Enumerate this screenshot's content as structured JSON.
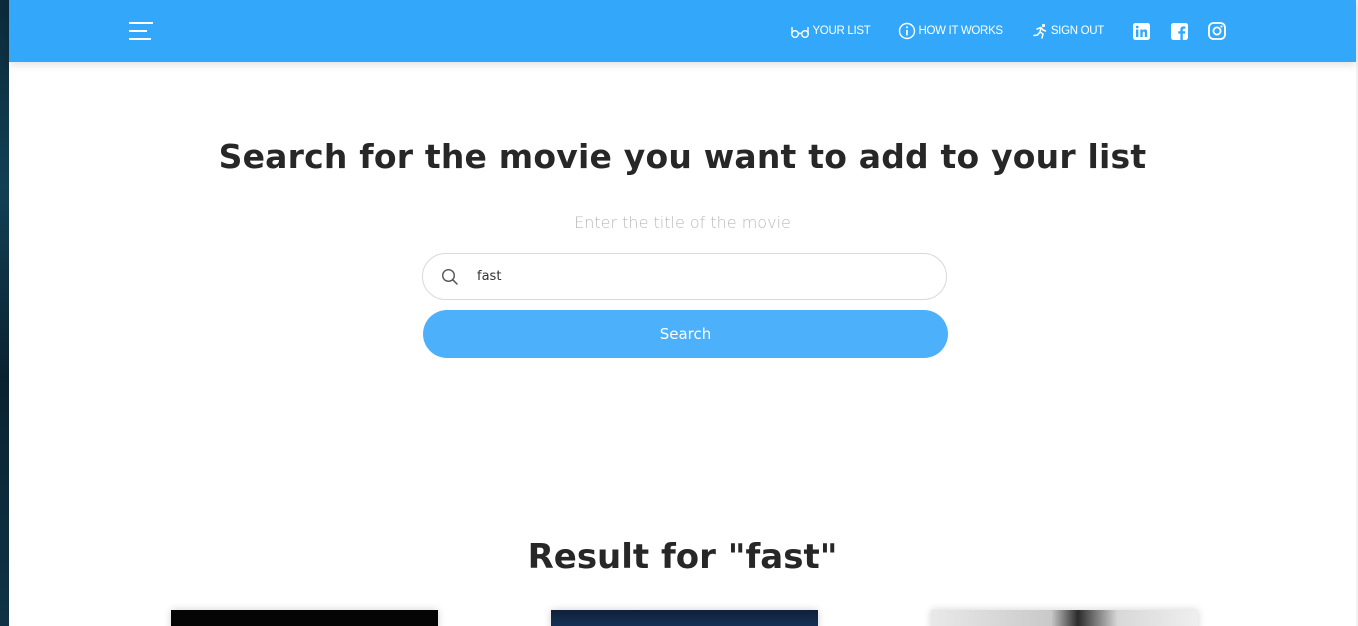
{
  "nav": {
    "menu_icon": "hamburger-menu-icon",
    "links": [
      {
        "label": "YOUR LIST",
        "icon": "glasses-icon"
      },
      {
        "label": "HOW IT WORKS",
        "icon": "info-circle-icon"
      },
      {
        "label": "SIGN OUT",
        "icon": "running-person-icon"
      }
    ],
    "social": [
      "linkedin-icon",
      "facebook-icon",
      "instagram-icon"
    ],
    "color": "#33a8fb"
  },
  "hero": {
    "title": "Search for the movie you want to add to your list",
    "subtitle": "Enter the title of the movie"
  },
  "search": {
    "value": "fast",
    "button_label": "Search",
    "button_color": "#4db0fb"
  },
  "results": {
    "title": "Result for \"fast\""
  }
}
